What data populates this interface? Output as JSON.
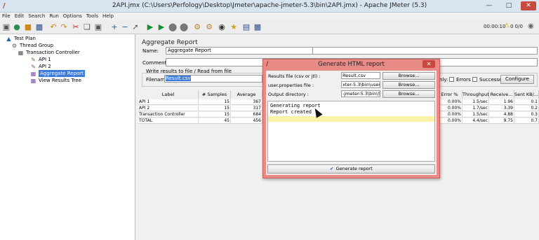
{
  "window": {
    "title": "2API.jmx (C:\\Users\\Perfology\\Desktop\\Jmeter\\apache-jmeter-5.3\\bin\\2API.jmx) - Apache JMeter (5.3)"
  },
  "menu": [
    "File",
    "Edit",
    "Search",
    "Run",
    "Options",
    "Tools",
    "Help"
  ],
  "toolbar": {
    "timer": "00:00:10",
    "counts": "0 0/0"
  },
  "tree": {
    "items": [
      {
        "label": "Test Plan",
        "icon": "test-plan-icon"
      },
      {
        "label": "Thread Group",
        "icon": "gear-icon"
      },
      {
        "label": "Transaction Controller",
        "icon": "controller-icon"
      },
      {
        "label": "API 1",
        "icon": "pencil-icon"
      },
      {
        "label": "API 2",
        "icon": "pencil-icon"
      },
      {
        "label": "Aggregate Report",
        "icon": "report-icon",
        "selected": true
      },
      {
        "label": "View Results Tree",
        "icon": "report-icon"
      }
    ]
  },
  "report": {
    "title": "Aggregate Report",
    "name_label": "Name:",
    "name_value": "Aggregate Report",
    "comments_label": "Comments:",
    "write_title": "Write results to file / Read from file",
    "filename_label": "Filename",
    "filename_value": "Result.csv",
    "log_only_suffix": "nly:",
    "errors_label": "Errors",
    "successes_label": "Successes",
    "configure_label": "Configure"
  },
  "table": {
    "headers": [
      "Label",
      "# Samples",
      "Average",
      "Error %",
      "Throughput",
      "Receive...",
      "Sent KB/..."
    ],
    "rows": [
      {
        "label": "API 1",
        "samples": "15",
        "average": "367",
        "error": "0.00%",
        "throughput": "1.5/sec",
        "received": "1.96",
        "sent": "0.1"
      },
      {
        "label": "API 2",
        "samples": "15",
        "average": "317",
        "error": "0.00%",
        "throughput": "1.7/sec",
        "received": "3.39",
        "sent": "0.2"
      },
      {
        "label": "Transaction Controller",
        "samples": "15",
        "average": "684",
        "error": "0.00%",
        "throughput": "1.5/sec",
        "received": "4.88",
        "sent": "0.3"
      },
      {
        "label": "TOTAL",
        "samples": "45",
        "average": "456",
        "error": "0.00%",
        "throughput": "4.4/sec",
        "received": "9.75",
        "sent": "0.7"
      }
    ]
  },
  "dialog": {
    "title": "Generate HTML report",
    "results_label": "Results file (csv or jtl) :",
    "results_value": "Result.csv",
    "props_label": "user.properties file :",
    "props_value": "xter-5.3\\bin\\user.properties",
    "output_label": "Output directory :",
    "output_value": "-jmeter-5.3\\bin\\Scripts\\html",
    "browse_label": "Browse...",
    "log_lines": [
      "Generating report",
      "Report created !"
    ],
    "generate_label": "Generate report"
  },
  "colors": {
    "dialog_border": "#e88a86",
    "selection": "#3d7bd9",
    "log_highlight": "#fbf2a8",
    "close_button": "#c84a3f"
  }
}
